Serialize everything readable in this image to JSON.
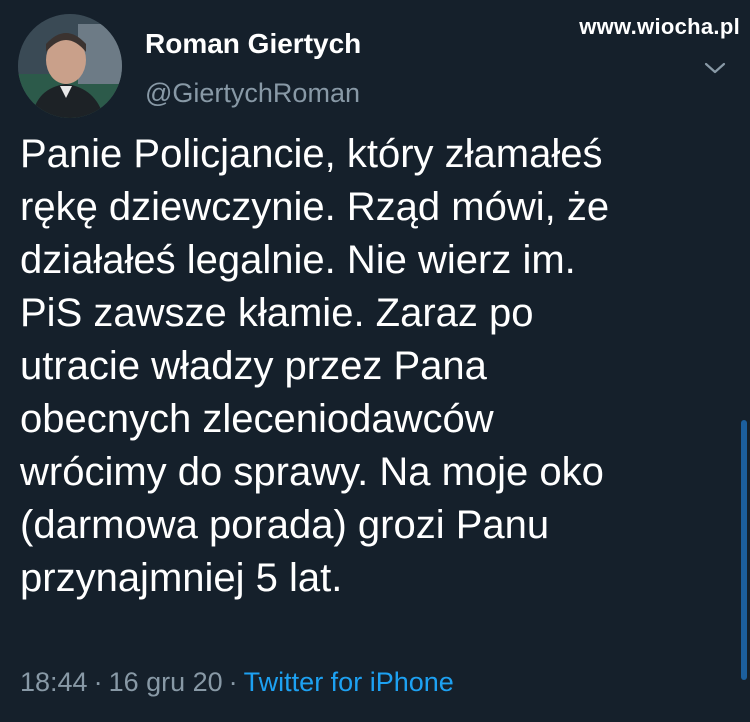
{
  "author": {
    "display_name": "Roman Giertych",
    "handle": "@GiertychRoman"
  },
  "watermark": "www.wiocha.pl",
  "tweet": {
    "text_lines": [
      "Panie Policjancie, który złamałeś",
      "rękę dziewczynie. Rząd mówi, że",
      "działałeś legalnie. Nie wierz im.",
      "PiS zawsze kłamie. Zaraz po",
      "utracie władzy przez Pana",
      "obecnych zleceniodawców",
      "wrócimy do sprawy. Na moje oko",
      "(darmowa porada) grozi Panu",
      "przynajmniej 5 lat."
    ],
    "time": "18:44",
    "date": "16 gru 20",
    "separator": "·",
    "source": "Twitter for iPhone"
  },
  "icons": {
    "more": "chevron-down-icon",
    "avatar": "avatar"
  },
  "colors": {
    "background": "#15202b",
    "text_primary": "#ffffff",
    "text_secondary": "#8899a6",
    "link": "#1da1f2"
  }
}
